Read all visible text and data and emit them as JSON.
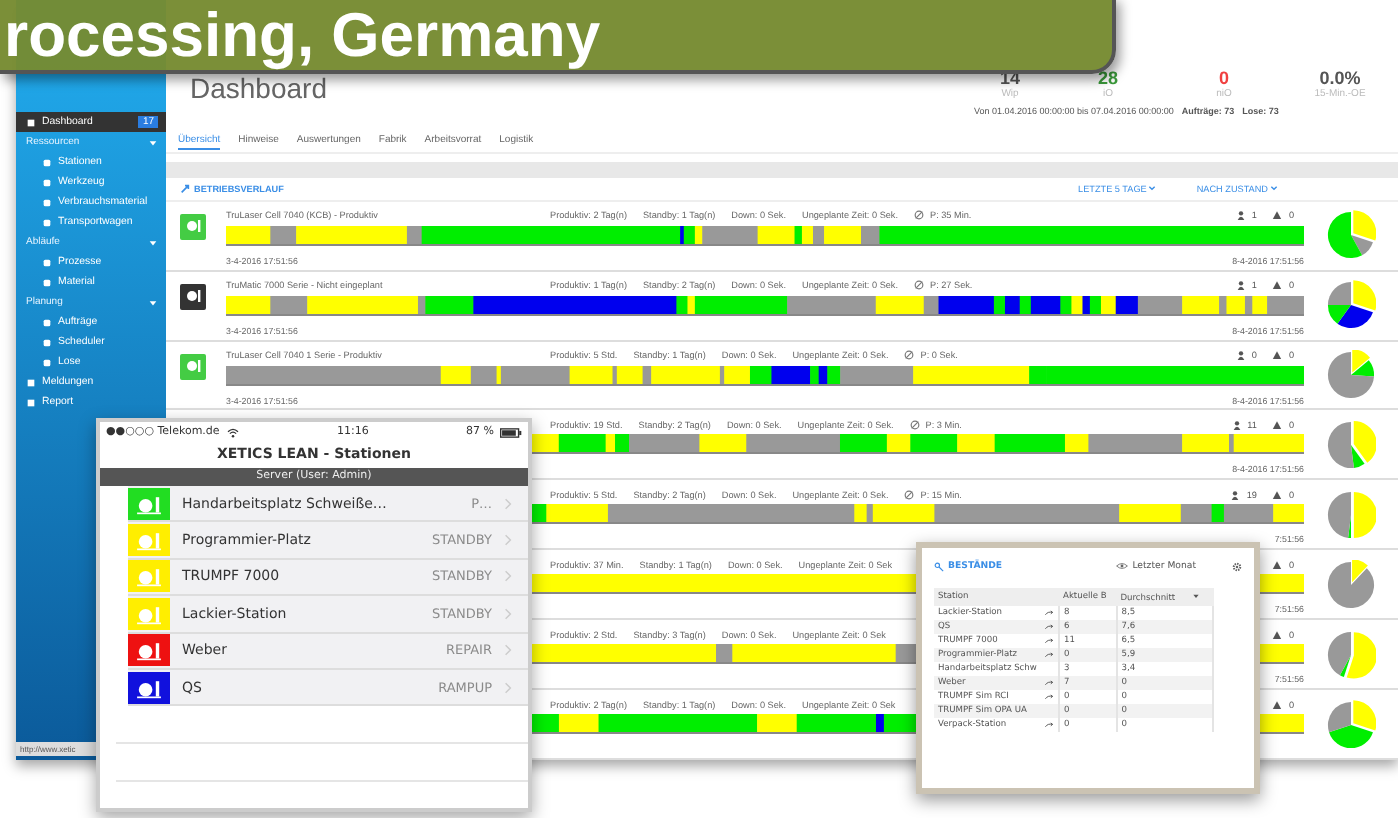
{
  "banner": {
    "text": "rocessing, Germany"
  },
  "sidebar": {
    "items": [
      {
        "label": "Dashboard",
        "selected": true,
        "badge": "17"
      },
      {
        "label": "Ressourcen",
        "selected": false,
        "children": [
          {
            "label": "Stationen",
            "selected": false
          },
          {
            "label": "Werkzeug",
            "selected": false
          },
          {
            "label": "Verbrauchsmaterial",
            "selected": false
          },
          {
            "label": "Transportwagen",
            "selected": false
          }
        ]
      },
      {
        "label": "Abläufe",
        "selected": false,
        "children": [
          {
            "label": "Prozesse",
            "selected": false
          },
          {
            "label": "Material",
            "selected": false
          }
        ]
      },
      {
        "label": "Planung",
        "selected": false,
        "children": [
          {
            "label": "Aufträge",
            "selected": false
          },
          {
            "label": "Scheduler",
            "selected": false
          },
          {
            "label": "Lose",
            "selected": false
          }
        ]
      },
      {
        "label": "Meldungen",
        "selected": false
      },
      {
        "label": "Report",
        "selected": false
      }
    ],
    "url": "http://www.xetic"
  },
  "page_title": "Dashboard",
  "kpis": [
    {
      "value": "14",
      "label": "Wip",
      "color": "#555555"
    },
    {
      "value": "28",
      "label": "iO",
      "color": "#3a9a3a"
    },
    {
      "value": "0",
      "label": "niO",
      "color": "#f04040"
    },
    {
      "value": "0.0%",
      "label": "15-Min.-OE",
      "color": "#555555"
    }
  ],
  "range": {
    "text": "Von 01.04.2016 00:00:00 bis 07.04.2016 00:00:00",
    "orders": "Aufträge: 73",
    "lots": "Lose: 73"
  },
  "tabs": [
    {
      "label": "Übersicht",
      "selected": true
    },
    {
      "label": "Hinweise",
      "selected": false
    },
    {
      "label": "Auswertungen",
      "selected": false
    },
    {
      "label": "Fabrik",
      "selected": false
    },
    {
      "label": "Arbeitsvorrat",
      "selected": false
    },
    {
      "label": "Logistik",
      "selected": false
    }
  ],
  "section": {
    "title": "BETRIEBSVERLAUF",
    "period": "LETZTE 5 TAGE",
    "grouping": "NACH ZUSTAND"
  },
  "rows": [
    {
      "color": "#44cc44",
      "name": "TruLaser Cell 7040 (KCB) - Produktiv",
      "stats": [
        "Produktiv: 2 Tag(n)",
        "Standby: 1 Tag(n)",
        "Down: 0 Sek.",
        "Ungeplante Zeit: 0 Sek."
      ],
      "p": "P: 35 Min.",
      "operators": "1",
      "alerts": "0",
      "start": "3-4-2016 17:51:56",
      "end": "8-4-2016 17:51:56"
    },
    {
      "color": "#333333",
      "name": "TruMatic 7000 Serie - Nicht eingeplant",
      "stats": [
        "Produktiv: 1 Tag(n)",
        "Standby: 2 Tag(n)",
        "Down: 0 Sek.",
        "Ungeplante Zeit: 0 Sek."
      ],
      "p": "P: 27 Sek.",
      "operators": "1",
      "alerts": "0",
      "start": "3-4-2016 17:51:56",
      "end": "8-4-2016 17:51:56"
    },
    {
      "color": "#44cc44",
      "name": "TruLaser Cell 7040 1 Serie - Produktiv",
      "stats": [
        "Produktiv: 5 Std.",
        "Standby: 1 Tag(n)",
        "Down: 0 Sek.",
        "Ungeplante Zeit: 0 Sek."
      ],
      "p": "P: 0 Sek.",
      "operators": "0",
      "alerts": "0",
      "start": "3-4-2016 17:51:56",
      "end": "8-4-2016 17:51:56"
    },
    {
      "stats": [
        "Produktiv: 19 Std.",
        "Standby: 2 Tag(n)",
        "Down: 0 Sek.",
        "Ungeplante Zeit: 0 Sek."
      ],
      "p": "P: 3 Min.",
      "operators": "11",
      "alerts": "0",
      "end": "8-4-2016 17:51:56"
    },
    {
      "stats": [
        "Produktiv: 5 Std.",
        "Standby: 2 Tag(n)",
        "Down: 0 Sek.",
        "Ungeplante Zeit: 0 Sek."
      ],
      "p": "P: 15 Min.",
      "operators": "19",
      "alerts": "0",
      "end": "7:51:56"
    },
    {
      "stats": [
        "Produktiv: 37 Min.",
        "Standby: 1 Tag(n)",
        "Down: 0 Sek.",
        "Ungeplante Zeit: 0 Sek"
      ],
      "alerts": "0",
      "end": "7:51:56"
    },
    {
      "stats": [
        "Produktiv: 2 Std.",
        "Standby: 3 Tag(n)",
        "Down: 0 Sek.",
        "Ungeplante Zeit: 0 Sek"
      ],
      "alerts": "0",
      "end": "7:51:56"
    },
    {
      "stats": [
        "Produktiv: 2 Tag(n)",
        "Standby: 1 Tag(n)",
        "Down: 0 Sek.",
        "Ungeplante Zeit: 0 Sek"
      ],
      "alerts": "0"
    }
  ],
  "phone": {
    "carrier": "●●○○○ Telekom.de",
    "time": "11:16",
    "battery": "87 %",
    "title": "XETICS LEAN - Stationen",
    "server": "Server (User: Admin)",
    "stations": [
      {
        "name": "Handarbeitsplatz Schweiße…",
        "status": "P…",
        "color": "#22dd22"
      },
      {
        "name": "Programmier-Platz",
        "status": "STANDBY",
        "color": "#ffee00"
      },
      {
        "name": "TRUMPF 7000",
        "status": "STANDBY",
        "color": "#ffee00"
      },
      {
        "name": "Lackier-Station",
        "status": "STANDBY",
        "color": "#ffee00"
      },
      {
        "name": "Weber",
        "status": "REPAIR",
        "color": "#ee1111"
      },
      {
        "name": "QS",
        "status": "RAMPUP",
        "color": "#1111dd"
      }
    ]
  },
  "stock_panel": {
    "title": "BESTÄNDE",
    "period": "Letzter Monat",
    "columns": [
      "Station",
      "Aktuelle B",
      "Durchschnitt"
    ],
    "rows": [
      {
        "station": "Lackier-Station",
        "link": true,
        "current": "8",
        "average": "8,5"
      },
      {
        "station": "QS",
        "link": true,
        "current": "6",
        "average": "7,6"
      },
      {
        "station": "TRUMPF 7000",
        "link": true,
        "current": "11",
        "average": "6,5"
      },
      {
        "station": "Programmier-Platz",
        "link": true,
        "current": "0",
        "average": "5,9"
      },
      {
        "station": "Handarbeitsplatz Schw",
        "link": false,
        "current": "3",
        "average": "3,4"
      },
      {
        "station": "Weber",
        "link": true,
        "current": "7",
        "average": "0"
      },
      {
        "station": "TRUMPF Sim RCI",
        "link": true,
        "current": "0",
        "average": "0"
      },
      {
        "station": "TRUMPF Sim OPA UA",
        "link": false,
        "current": "0",
        "average": "0"
      },
      {
        "station": "Verpack-Station",
        "link": true,
        "current": "0",
        "average": "0"
      }
    ]
  }
}
